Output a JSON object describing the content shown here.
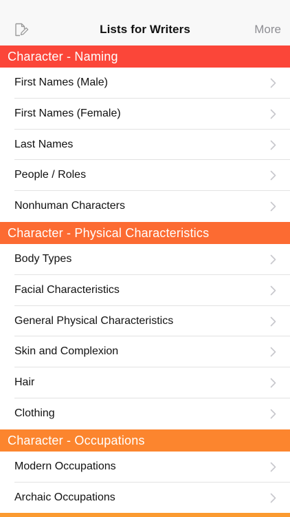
{
  "navbar": {
    "title": "Lists for Writers",
    "more_label": "More",
    "left_icon": "compose-icon"
  },
  "colors": {
    "navbar_bg": "#f8f8f8",
    "section_naming": "#fb4639",
    "section_physical": "#fc6b32",
    "section_occupations": "#fc852e",
    "section_next": "#fb9a30",
    "chevron": "#c7c7cc"
  },
  "sections": [
    {
      "title": "Character - Naming",
      "color": "#fb4639",
      "items": [
        "First Names (Male)",
        "First Names (Female)",
        "Last Names",
        "People / Roles",
        "Nonhuman Characters"
      ]
    },
    {
      "title": "Character - Physical Characteristics",
      "color": "#fc6b32",
      "items": [
        "Body Types",
        "Facial Characteristics",
        "General Physical Characteristics",
        "Skin and Complexion",
        "Hair",
        "Clothing"
      ]
    },
    {
      "title": "Character - Occupations",
      "color": "#fc852e",
      "items": [
        "Modern Occupations",
        "Archaic Occupations"
      ]
    }
  ]
}
